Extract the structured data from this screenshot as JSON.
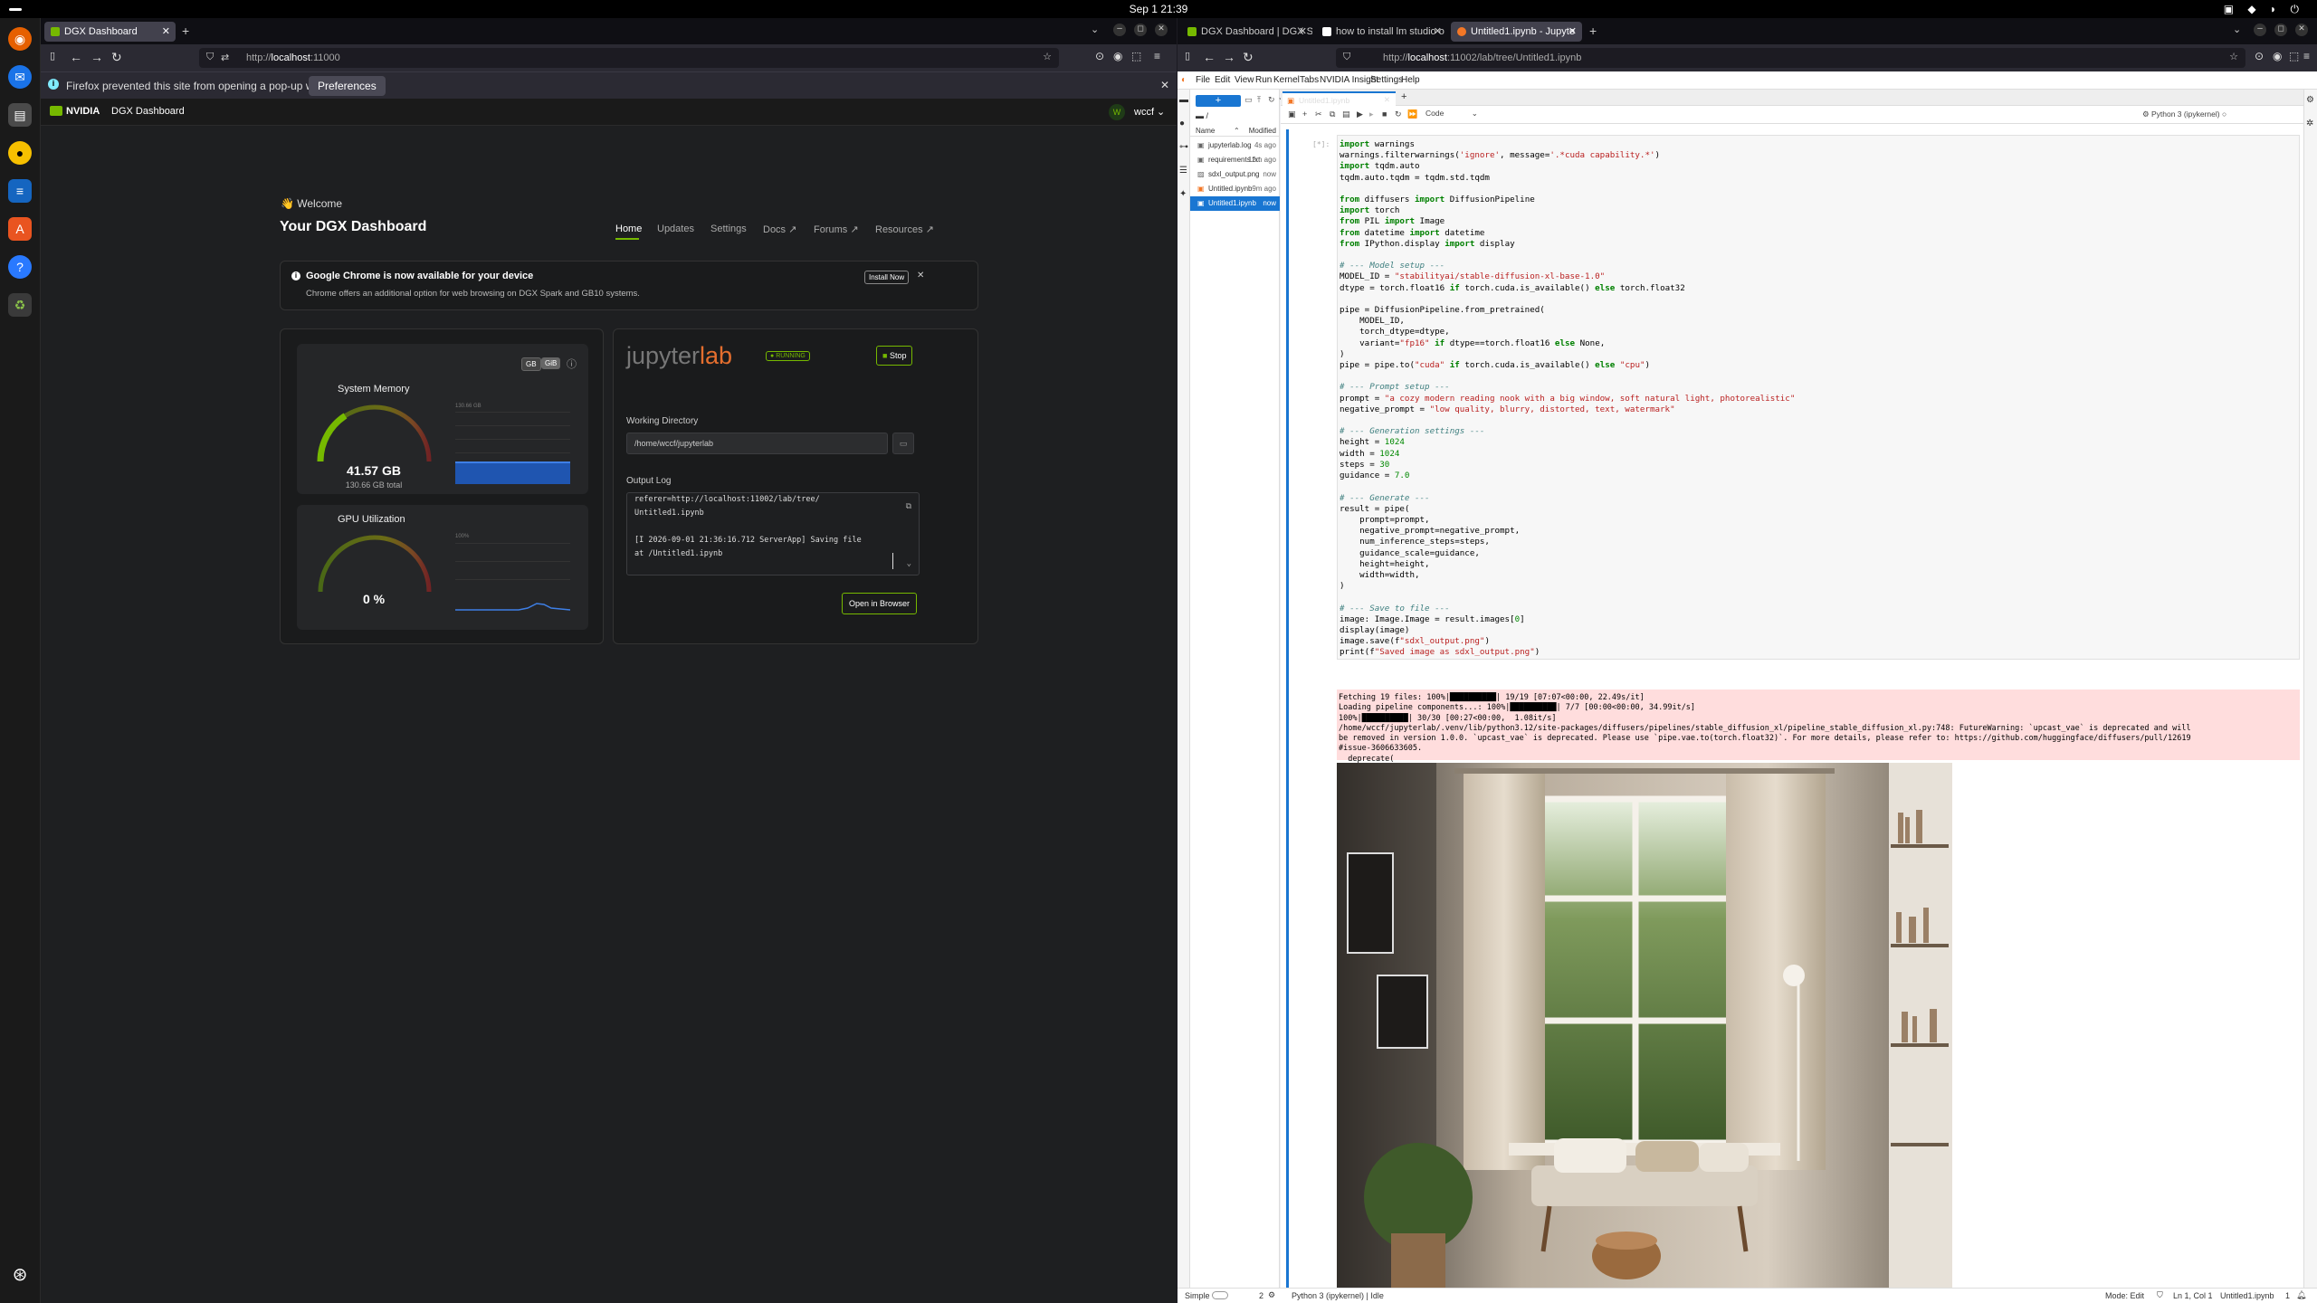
{
  "system": {
    "clock": "Sep 1  21:39"
  },
  "left_window": {
    "tab_title": "DGX Dashboard",
    "url_prefix": "http://",
    "url_host": "localhost",
    "url_port": ":11000",
    "popup_message": "Firefox prevented this site from opening a pop-up window.",
    "popup_button": "Preferences"
  },
  "dgx": {
    "brand": "NVIDIA",
    "app_title": "DGX Dashboard",
    "user_initial": "W",
    "user_name": "wccf",
    "welcome": "👋 Welcome",
    "page_title": "Your DGX Dashboard",
    "nav": {
      "home": "Home",
      "updates": "Updates",
      "settings": "Settings",
      "docs": "Docs ↗",
      "forums": "Forums ↗",
      "resources": "Resources ↗"
    },
    "banner": {
      "title": "Google Chrome is now available for your device",
      "body": "Chrome offers an additional option for web browsing on DGX Spark and GB10 systems.",
      "button": "Install Now"
    },
    "memory": {
      "unit_gb": "GB",
      "unit_gib": "GiB",
      "title": "System Memory",
      "value": "41.57 GB",
      "total": "130.66 GB total",
      "fraction": 0.318,
      "axis_max": "130.66 GB"
    },
    "gpu": {
      "title": "GPU Utilization",
      "value": "0 %",
      "fraction": 0.0,
      "axis_max": "100%"
    },
    "jupyter": {
      "logo_a": "jupyter",
      "logo_b": "lab",
      "status": "RUNNING",
      "stop": "Stop",
      "wd_label": "Working Directory",
      "wd_value": "/home/wccf/jupyterlab",
      "log_label": "Output Log",
      "log_lines": [
        "referer=http://localhost:11002/lab/tree/",
        "Untitled1.ipynb",
        "",
        "[I 2026-09-01 21:36:16.712 ServerApp] Saving file",
        "at /Untitled1.ipynb"
      ],
      "open_btn": "Open in Browser"
    }
  },
  "right_window": {
    "tabs": [
      "DGX Dashboard | DGX Sp",
      "how to install lm studio o",
      "Untitled1.ipynb - Jupyte"
    ],
    "url_prefix": "http://",
    "url_host": "localhost",
    "url_path": ":11002/lab/tree/Untitled1.ipynb"
  },
  "jupyterlab": {
    "menu": [
      "File",
      "Edit",
      "View",
      "Run",
      "Kernel",
      "Tabs",
      "NVIDIA Insight",
      "Settings",
      "Help"
    ],
    "path": "/",
    "col_name": "Name",
    "col_modified": "Modified",
    "files": [
      {
        "name": "jupyterlab.log",
        "mod": "4s ago"
      },
      {
        "name": "requirements.txt",
        "mod": "12m ago"
      },
      {
        "name": "sdxl_output.png",
        "mod": "now"
      },
      {
        "name": "Untitled.ipynb",
        "mod": "9m ago"
      },
      {
        "name": "Untitled1.ipynb",
        "mod": "now"
      }
    ],
    "doc_tab": "Untitled1.ipynb",
    "cell_type": "Code",
    "kernel": "Python 3 (ipykernel)",
    "prompt": "[*]:",
    "output_lines": [
      "Fetching 19 files: 100%|██████████| 19/19 [07:07<00:00, 22.49s/it]",
      "Loading pipeline components...: 100%|██████████| 7/7 [00:00<00:00, 34.99it/s]",
      "100%|██████████| 30/30 [00:27<00:00,  1.08it/s]",
      "/home/wccf/jupyterlab/.venv/lib/python3.12/site-packages/diffusers/pipelines/stable_diffusion_xl/pipeline_stable_diffusion_xl.py:748: FutureWarning: `upcast_vae` is deprecated and will",
      "be removed in version 1.0.0. `upcast_vae` is deprecated. Please use `pipe.vae.to(torch.float32)`. For more details, please refer to: https://github.com/huggingface/diffusers/pull/12619",
      "#issue-3606633605.",
      "  deprecate("
    ],
    "status": {
      "mode_simple": "Simple",
      "count": "2",
      "kernel_status": "Python 3 (ipykernel) | Idle",
      "mode": "Mode: Edit",
      "pos": "Ln 1, Col 1",
      "file": "Untitled1.ipynb",
      "bell": "1"
    }
  }
}
